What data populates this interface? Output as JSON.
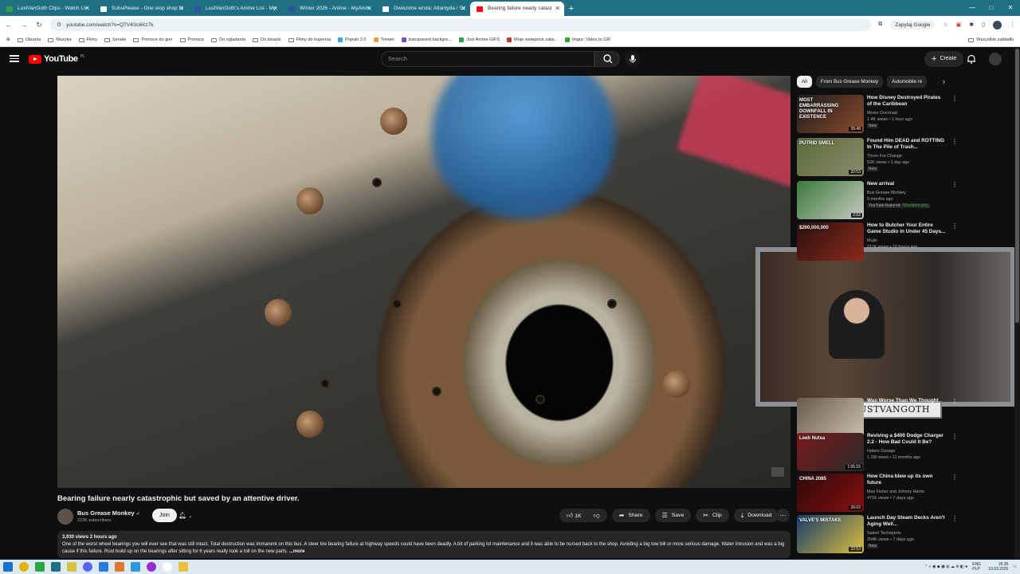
{
  "browser": {
    "tabs": [
      {
        "label": "LustVanGoth Clips - Watch Liv",
        "color": "#2ba640"
      },
      {
        "label": "SubsPlease - One stop shop fo",
        "color": "#ffffff"
      },
      {
        "label": "LustVanGoth's Anime List - My",
        "color": "#2e51a2"
      },
      {
        "label": "Winter 2026 - Anime - MyAnim",
        "color": "#2e51a2"
      },
      {
        "label": "Gwiezdne wrota: Atlantyda / Sz",
        "color": "#ffffff"
      },
      {
        "label": "Bearing failure nearly catast",
        "color": "#ff0000",
        "active": true
      }
    ],
    "url": "youtube.com/watch?v=QTV4Sc6Xz7k",
    "translate_label": "Zapytaj Google",
    "bookmarks": [
      {
        "label": "Ubrania",
        "folder": true
      },
      {
        "label": "Muzyka",
        "folder": true
      },
      {
        "label": "Filmy",
        "folder": true
      },
      {
        "label": "Seriale",
        "folder": true
      },
      {
        "label": "Pomoce do gier",
        "folder": true
      },
      {
        "label": "Pomoce",
        "folder": true
      },
      {
        "label": "Do ogladania",
        "folder": true
      },
      {
        "label": "Do ksiazki",
        "folder": true
      },
      {
        "label": "Filmy do kupienia",
        "folder": true
      },
      {
        "label": "Popuki 2.0",
        "folder": false,
        "color": "#3aa3d8"
      },
      {
        "label": "Trewer",
        "folder": false,
        "color": "#e8a23a"
      },
      {
        "label": "transparent backgro...",
        "folder": false,
        "color": "#7a4fc0"
      },
      {
        "label": "Just Anime GIFS",
        "folder": false,
        "color": "#2ba640"
      },
      {
        "label": "Moje wsteprnie zalw...",
        "folder": false,
        "color": "#c0392b"
      },
      {
        "label": "Imgur: Video to GIF",
        "folder": false,
        "color": "#2ba640"
      }
    ],
    "bookmarks_all": "Wszystkie zakładki"
  },
  "youtube": {
    "logo_text": "YouTube",
    "logo_country": "PL",
    "search_placeholder": "Search",
    "create_label": "Create"
  },
  "video": {
    "title": "Bearing failure nearly catastrophic but saved by an attentive driver.",
    "channel": "Bus Grease Monkey",
    "subscribers": "222K subscribers",
    "join_label": "Join",
    "likes": "1K",
    "share_label": "Share",
    "save_label": "Save",
    "clip_label": "Clip",
    "download_label": "Download",
    "views_date": "3,930 views  2 hours ago",
    "description": "One of the worst wheel bearings you will ever see that was still intact.  Total destruction was immanent on this bus.  A steer tire bearing failure at highway speeds could have been deadly.  A bit of parking lot maintenance and it was able to be nursed back to the shop.  Avoiding a big tow bill or more serious damage.  Water intrusion and was a big cause if this failure.  Rust build up on the bearings after sitting for 6 years really took a toll on the new parts.",
    "more_label": "...more"
  },
  "webcam": {
    "nameplate": "LUSTVANGOTH"
  },
  "sidebar": {
    "chips": [
      "All",
      "From Bus Grease Monkey",
      "Automobile re"
    ],
    "recommendations": [
      {
        "title": "How Disney Destroyed Pirates of the Caribbean",
        "channel": "Movie Overload",
        "stats": "1.4K views • 1 hour ago",
        "tag": "New",
        "duration": "39:48",
        "thumb_text": "MOST EMBARRASSING DOWNFALL IN EXISTENCE",
        "c1": "#1d1d1d",
        "c2": "#8a4a2a"
      },
      {
        "title": "Found Him DEAD and ROTTING In The Pile of Trash...",
        "channel": "Three For Change",
        "stats": "52K views • 1 day ago",
        "tag": "New",
        "duration": "32:53",
        "thumb_text": "PUTRID SMELL",
        "c1": "#5a6a3a",
        "c2": "#8c8a6a"
      },
      {
        "title": "New arrival",
        "channel": "Bus Grease Monkey",
        "stats": "9 months ago",
        "tag": "YouTube featured",
        "member": "Members only",
        "duration": "2:02",
        "thumb_text": "",
        "c1": "#3a7a3a",
        "c2": "#c8c8c0"
      },
      {
        "title": "How to Butcher Your Entire Game Studio in Under 45 Days...",
        "channel": "Mujin",
        "stats": "211K views • 10 hours ago",
        "tag": "",
        "duration": "",
        "thumb_text": "$200,000,000",
        "c1": "#2a1010",
        "c2": "#8a2a1a"
      },
      {
        "title": "Was Worse Than We Thought",
        "channel": "",
        "stats": "",
        "tag": "",
        "duration": "",
        "thumb_text": "",
        "c1": "#6a5a4a",
        "c2": "#c8c0b0"
      },
      {
        "title": "Reviving a $400 Dodge Charger 2.2 - How Bad Could It Be?",
        "channel": "Haters Garage",
        "stats": "1.1M views • 11 months ago",
        "tag": "",
        "duration": "1:05:15",
        "thumb_text": "Leeb Nutsa",
        "c1": "#7a1a1a",
        "c2": "#2a2a2a"
      },
      {
        "title": "How China blew up its own future",
        "channel": "Max Fisher and Johnny Harris",
        "stats": "471K views • 7 days ago",
        "tag": "",
        "duration": "26:02",
        "thumb_text": "CHINA 2085",
        "c1": "#2a0808",
        "c2": "#8a1010"
      },
      {
        "title": "Launch Day Steam Decks Aren't Aging Well...",
        "channel": "Salem Techsperts",
        "stats": "204K views • 7 days ago",
        "tag": "New",
        "duration": "22:53",
        "thumb_text": "VALVE'S MISTAKE",
        "c1": "#1a3a6a",
        "c2": "#d8c040"
      }
    ]
  },
  "taskbar": {
    "lang": "ENG PLP",
    "time": "15:35",
    "date": "10.03.2026"
  }
}
